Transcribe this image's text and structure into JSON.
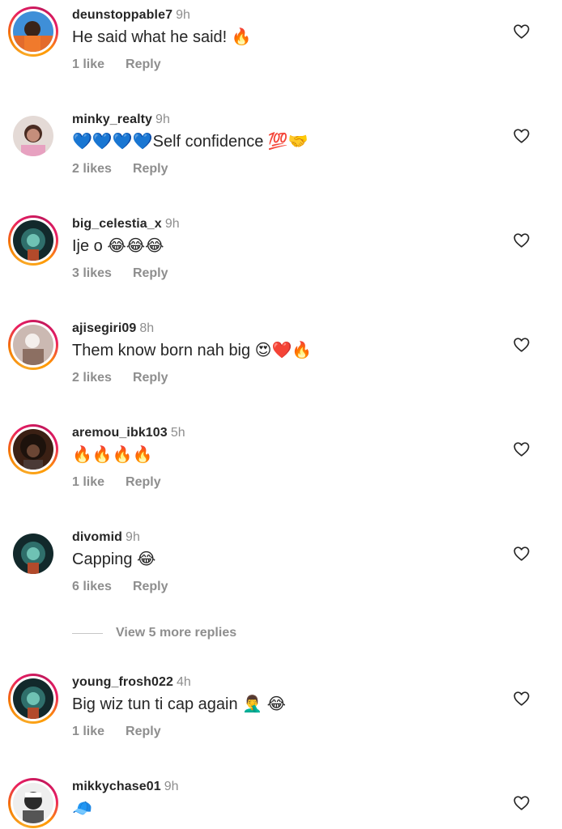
{
  "comments": [
    {
      "username": "deunstoppable7",
      "time": "9h",
      "text": "He said what he said! 🔥",
      "likes": "1 like",
      "reply": "Reply",
      "story": true,
      "avatar_color": "#3f8fd8"
    },
    {
      "username": "minky_realty",
      "time": "9h",
      "text": "💙💙💙💙Self confidence 💯🤝",
      "likes": "2 likes",
      "reply": "Reply",
      "story": false,
      "avatar_color": "#c9a3a0"
    },
    {
      "username": "big_celestia_x",
      "time": "9h",
      "text": "Ije o 😂😂😂",
      "likes": "3 likes",
      "reply": "Reply",
      "story": true,
      "avatar_color": "#1d3a3a"
    },
    {
      "username": "ajisegiri09",
      "time": "8h",
      "text": "Them know born nah big 😍❤️🔥",
      "likes": "2 likes",
      "reply": "Reply",
      "story": true,
      "avatar_color": "#cbb9b2"
    },
    {
      "username": "aremou_ibk103",
      "time": "5h",
      "text": "🔥🔥🔥🔥",
      "likes": "1 like",
      "reply": "Reply",
      "story": true,
      "avatar_color": "#2a1a12"
    },
    {
      "username": "divomid",
      "time": "9h",
      "text": "Capping 😂",
      "likes": "6 likes",
      "reply": "Reply",
      "story": false,
      "avatar_color": "#1d3a3a"
    },
    {
      "username": "young_frosh022",
      "time": "4h",
      "text": "Big wiz tun ti cap again 🤦‍♂️ 😂",
      "likes": "1 like",
      "reply": "Reply",
      "story": true,
      "avatar_color": "#1d3a3a"
    },
    {
      "username": "mikkychase01",
      "time": "9h",
      "text": "🧢",
      "likes": "",
      "reply": "",
      "story": true,
      "avatar_color": "#d9d9d9"
    }
  ],
  "view_more": "View 5 more replies",
  "icons": {
    "like": "heart-outline-icon"
  },
  "colors": {
    "username": "#262626",
    "muted": "#8e8e8e",
    "story_ring_start": "#f9a825",
    "story_ring_end": "#e91e63"
  }
}
